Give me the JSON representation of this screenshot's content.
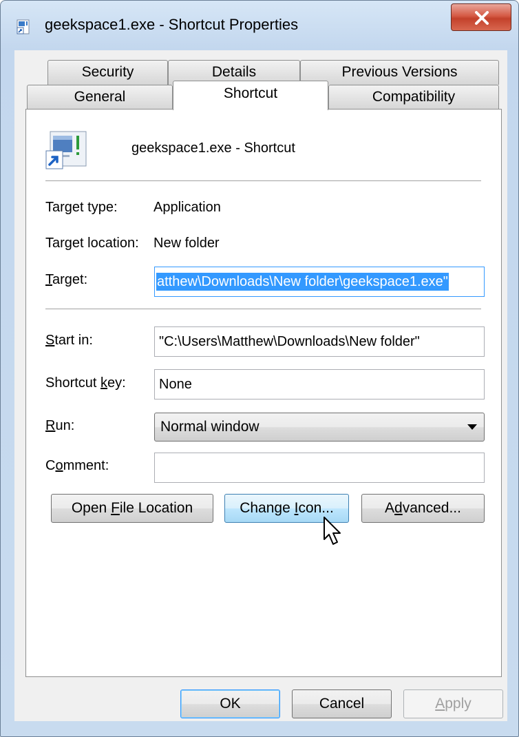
{
  "window": {
    "title": "geekspace1.exe - Shortcut Properties",
    "close_label": "close"
  },
  "tabs": [
    {
      "label": "Security"
    },
    {
      "label": "Details"
    },
    {
      "label": "Previous Versions"
    },
    {
      "label": "General"
    },
    {
      "label": "Shortcut"
    },
    {
      "label": "Compatibility"
    }
  ],
  "active_tab": "Shortcut",
  "shortcut": {
    "name": "geekspace1.exe - Shortcut",
    "target_type_label": "Target type:",
    "target_type_value": "Application",
    "target_location_label": "Target location:",
    "target_location_value": "New folder",
    "target_label_u": "T",
    "target_label_rest": "arget:",
    "target_value": "atthew\\Downloads\\New folder\\geekspace1.exe\"",
    "start_in_label_u": "S",
    "start_in_label_rest": "tart in:",
    "start_in_value": "\"C:\\Users\\Matthew\\Downloads\\New folder\"",
    "shortcut_key_label_pre": "Shortcut ",
    "shortcut_key_label_u": "k",
    "shortcut_key_label_rest": "ey:",
    "shortcut_key_value": "None",
    "run_label_u": "R",
    "run_label_rest": "un:",
    "run_value": "Normal window",
    "comment_label_pre": "C",
    "comment_label_u": "o",
    "comment_label_rest": "mment:",
    "comment_value": ""
  },
  "actions": {
    "open_file_location_pre": "Open ",
    "open_file_location_u": "F",
    "open_file_location_rest": "ile Location",
    "change_icon_pre": "Change ",
    "change_icon_u": "I",
    "change_icon_rest": "con...",
    "advanced_pre": "A",
    "advanced_u": "d",
    "advanced_rest": "vanced..."
  },
  "footer": {
    "ok": "OK",
    "cancel": "Cancel",
    "apply_u": "A",
    "apply_rest": "pply"
  },
  "colors": {
    "selection": "#3399ff",
    "close_button": "#c3412b",
    "titlebar": "#c3d7ee"
  }
}
